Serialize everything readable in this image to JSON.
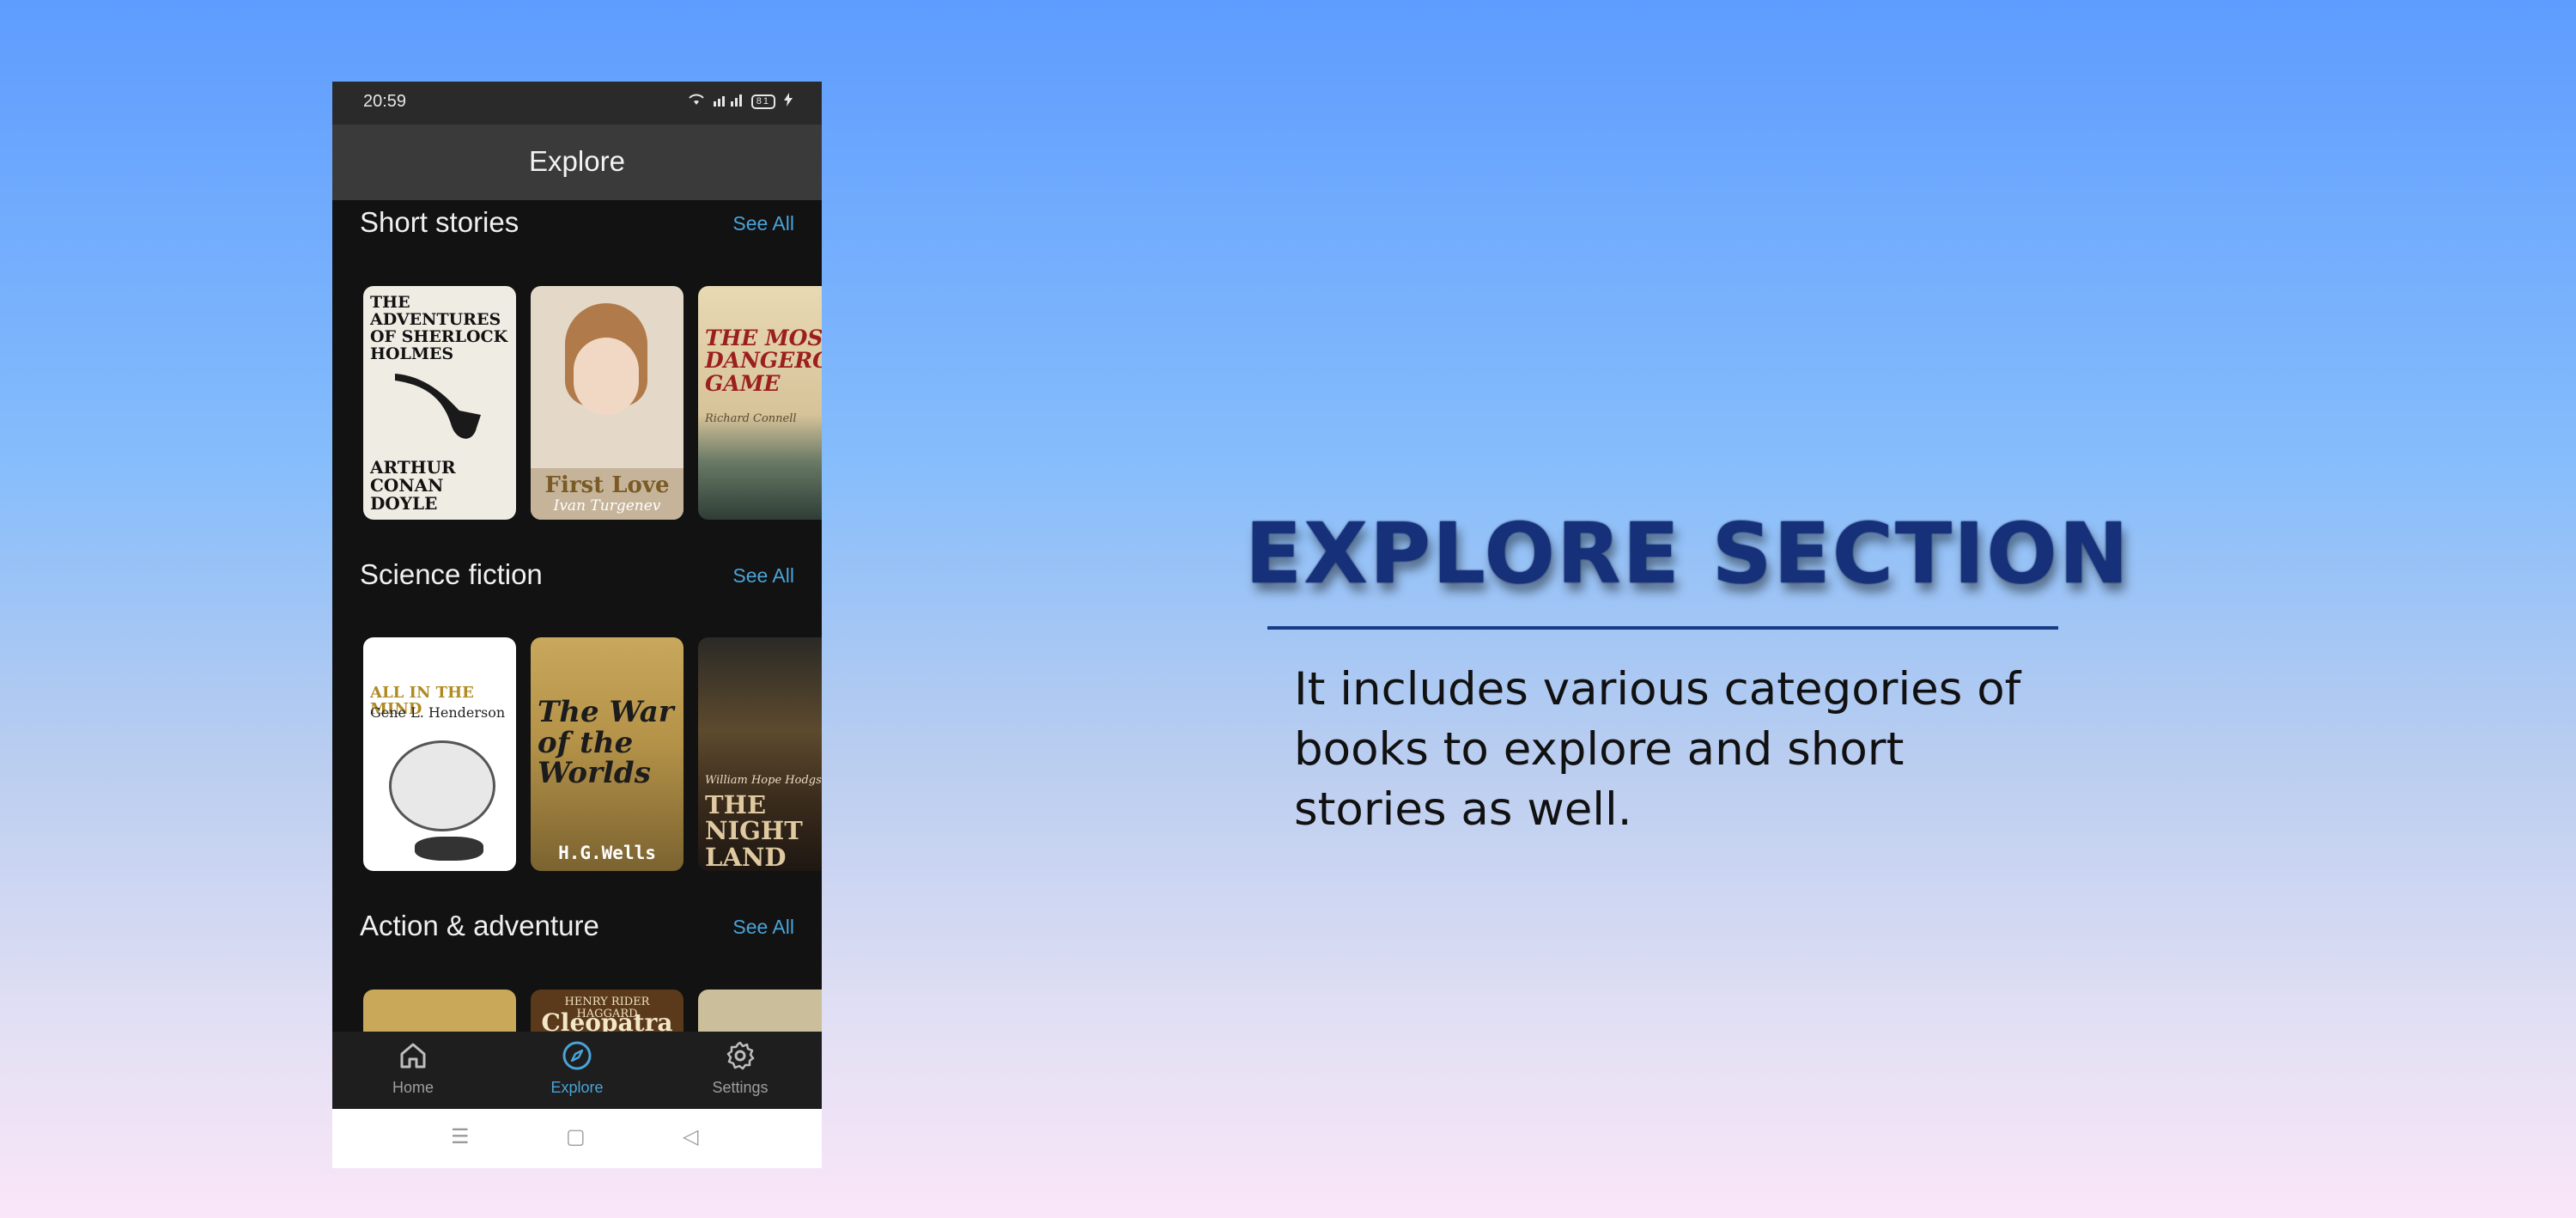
{
  "phone": {
    "status": {
      "time": "20:59",
      "battery": "81"
    },
    "appbar": {
      "title": "Explore"
    },
    "sections": [
      {
        "title": "Short stories",
        "see_all": "See All",
        "books": [
          {
            "line1": "THE ADVENTURES OF SHERLOCK HOLMES",
            "line2": "ARTHUR CONAN DOYLE"
          },
          {
            "line1": "First Love",
            "line2": "Ivan Turgenev"
          },
          {
            "line1": "THE MOST DANGEROUS GAME",
            "line2": "Richard Connell"
          }
        ]
      },
      {
        "title": "Science fiction",
        "see_all": "See All",
        "books": [
          {
            "line1": "ALL IN THE MIND",
            "line2": "Gene L. Henderson"
          },
          {
            "line1": "The War of the Worlds",
            "line2": "H.G.Wells"
          },
          {
            "line1": "THE NIGHT LAND",
            "line2": "William Hope Hodgson"
          }
        ]
      },
      {
        "title": "Action & adventure",
        "see_all": "See All",
        "books": [
          {
            "line1": "",
            "line2": ""
          },
          {
            "line1": "HENRY RIDER HAGGARD",
            "line2": "Cleopatra"
          },
          {
            "line1": "",
            "line2": ""
          }
        ]
      }
    ],
    "nav": {
      "home": "Home",
      "explore": "Explore",
      "settings": "Settings"
    },
    "accent": "#4aa3d8"
  },
  "slide": {
    "heading": "EXPLORE SECTION",
    "description": "It includes various categories of books to explore and short stories as well."
  }
}
